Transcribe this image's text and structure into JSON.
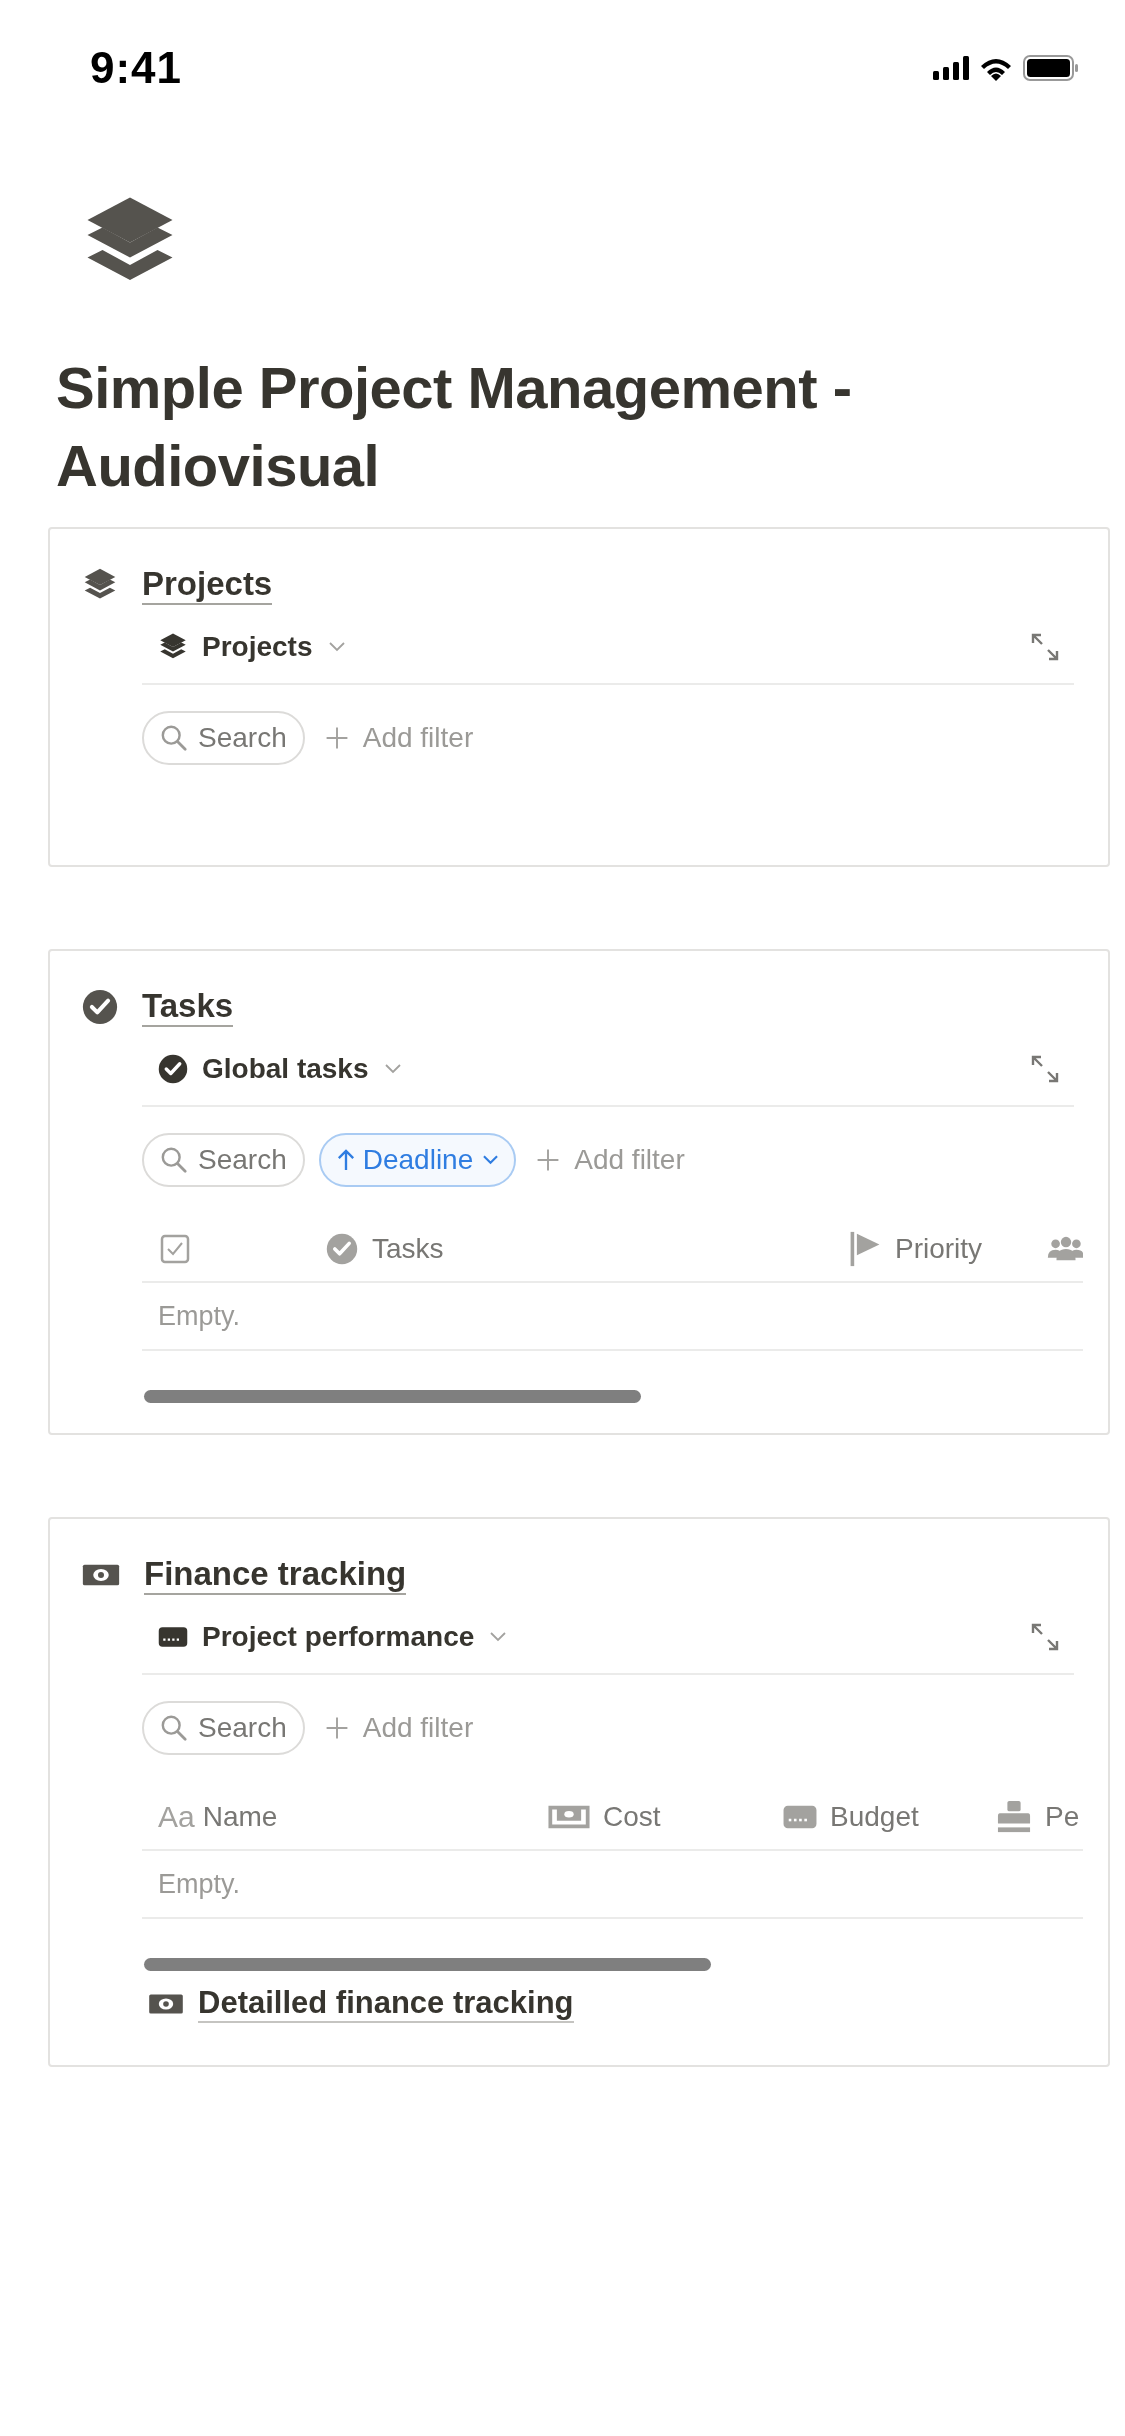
{
  "status_bar": {
    "time": "9:41"
  },
  "page": {
    "title": "Simple Project Management - Audiovisual"
  },
  "cards": [
    {
      "kind": "layers",
      "title": "Projects",
      "view": {
        "kind": "layers",
        "label": "Projects"
      },
      "search": {
        "placeholder": "Search"
      },
      "add_filter": "Add filter"
    },
    {
      "kind": "check",
      "title": "Tasks",
      "view": {
        "kind": "check",
        "label": "Global tasks"
      },
      "search": {
        "placeholder": "Search"
      },
      "sort": {
        "label": "Deadline"
      },
      "add_filter": "Add filter",
      "table": {
        "columns": [
          {
            "kind": "checkbox"
          },
          {
            "kind": "status",
            "label": "Tasks"
          },
          {
            "kind": "flag",
            "label": "Priority"
          },
          {
            "kind": "people"
          }
        ],
        "empty": "Empty."
      }
    },
    {
      "kind": "money",
      "title": "Finance tracking",
      "view": {
        "kind": "card",
        "label": "Project performance"
      },
      "search": {
        "placeholder": "Search"
      },
      "add_filter": "Add filter",
      "table": {
        "columns": [
          {
            "kind": "text",
            "icon_text": "Aa",
            "label": "Name"
          },
          {
            "kind": "tray",
            "label": "Cost"
          },
          {
            "kind": "card",
            "label": "Budget"
          },
          {
            "kind": "stamp",
            "label": "Pe"
          }
        ],
        "empty": "Empty."
      },
      "link": {
        "kind": "money",
        "label": "Detailled finance tracking"
      }
    }
  ]
}
